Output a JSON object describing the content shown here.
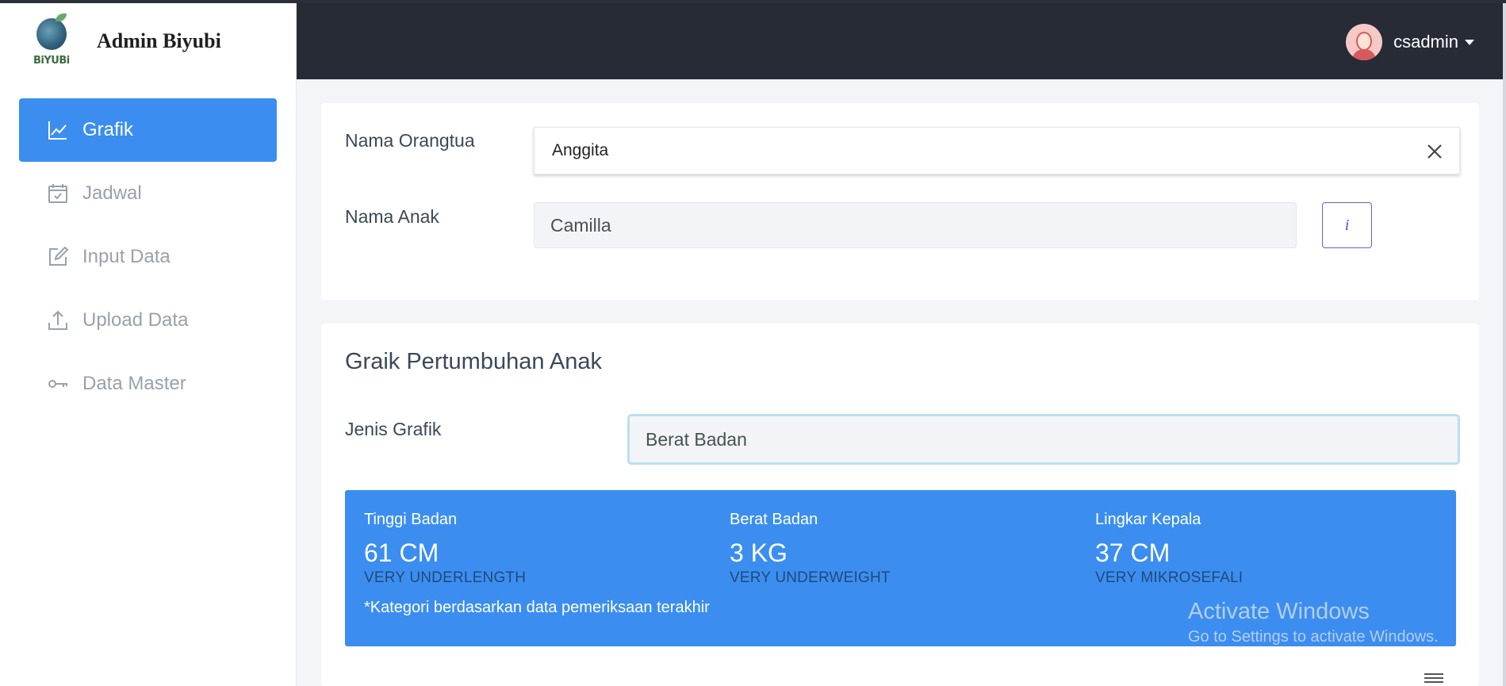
{
  "brand": {
    "title": "Admin Biyubi",
    "logo_text": "BiYUBi"
  },
  "sidebar": {
    "items": [
      {
        "label": "Grafik",
        "icon": "line-chart-icon",
        "active": true
      },
      {
        "label": "Jadwal",
        "icon": "calendar-check-icon",
        "active": false
      },
      {
        "label": "Input Data",
        "icon": "edit-icon",
        "active": false
      },
      {
        "label": "Upload Data",
        "icon": "upload-icon",
        "active": false
      },
      {
        "label": "Data Master",
        "icon": "key-icon",
        "active": false
      }
    ]
  },
  "header": {
    "username": "csadmin"
  },
  "form": {
    "parent_label": "Nama Orangtua",
    "parent_value": "Anggita",
    "child_label": "Nama Anak",
    "child_value": "Camilla",
    "info_button": "i"
  },
  "growth": {
    "title": "Graik Pertumbuhan Anak",
    "chart_type_label": "Jenis Grafik",
    "chart_type_value": "Berat Badan",
    "stats": [
      {
        "label": "Tinggi Badan",
        "value": "61 CM",
        "category": "VERY UNDERLENGTH"
      },
      {
        "label": "Berat Badan",
        "value": "3 KG",
        "category": "VERY UNDERWEIGHT"
      },
      {
        "label": "Lingkar Kepala",
        "value": "37 CM",
        "category": "VERY MIKROSEFALI"
      }
    ],
    "footnote": "*Kategori berdasarkan data pemeriksaan terakhir"
  },
  "watermark": {
    "line1": "Activate Windows",
    "line2": "Go to Settings to activate Windows."
  },
  "colors": {
    "primary": "#3b8ef0",
    "header_bg": "#262b36",
    "info_border": "#6f5bd8"
  }
}
